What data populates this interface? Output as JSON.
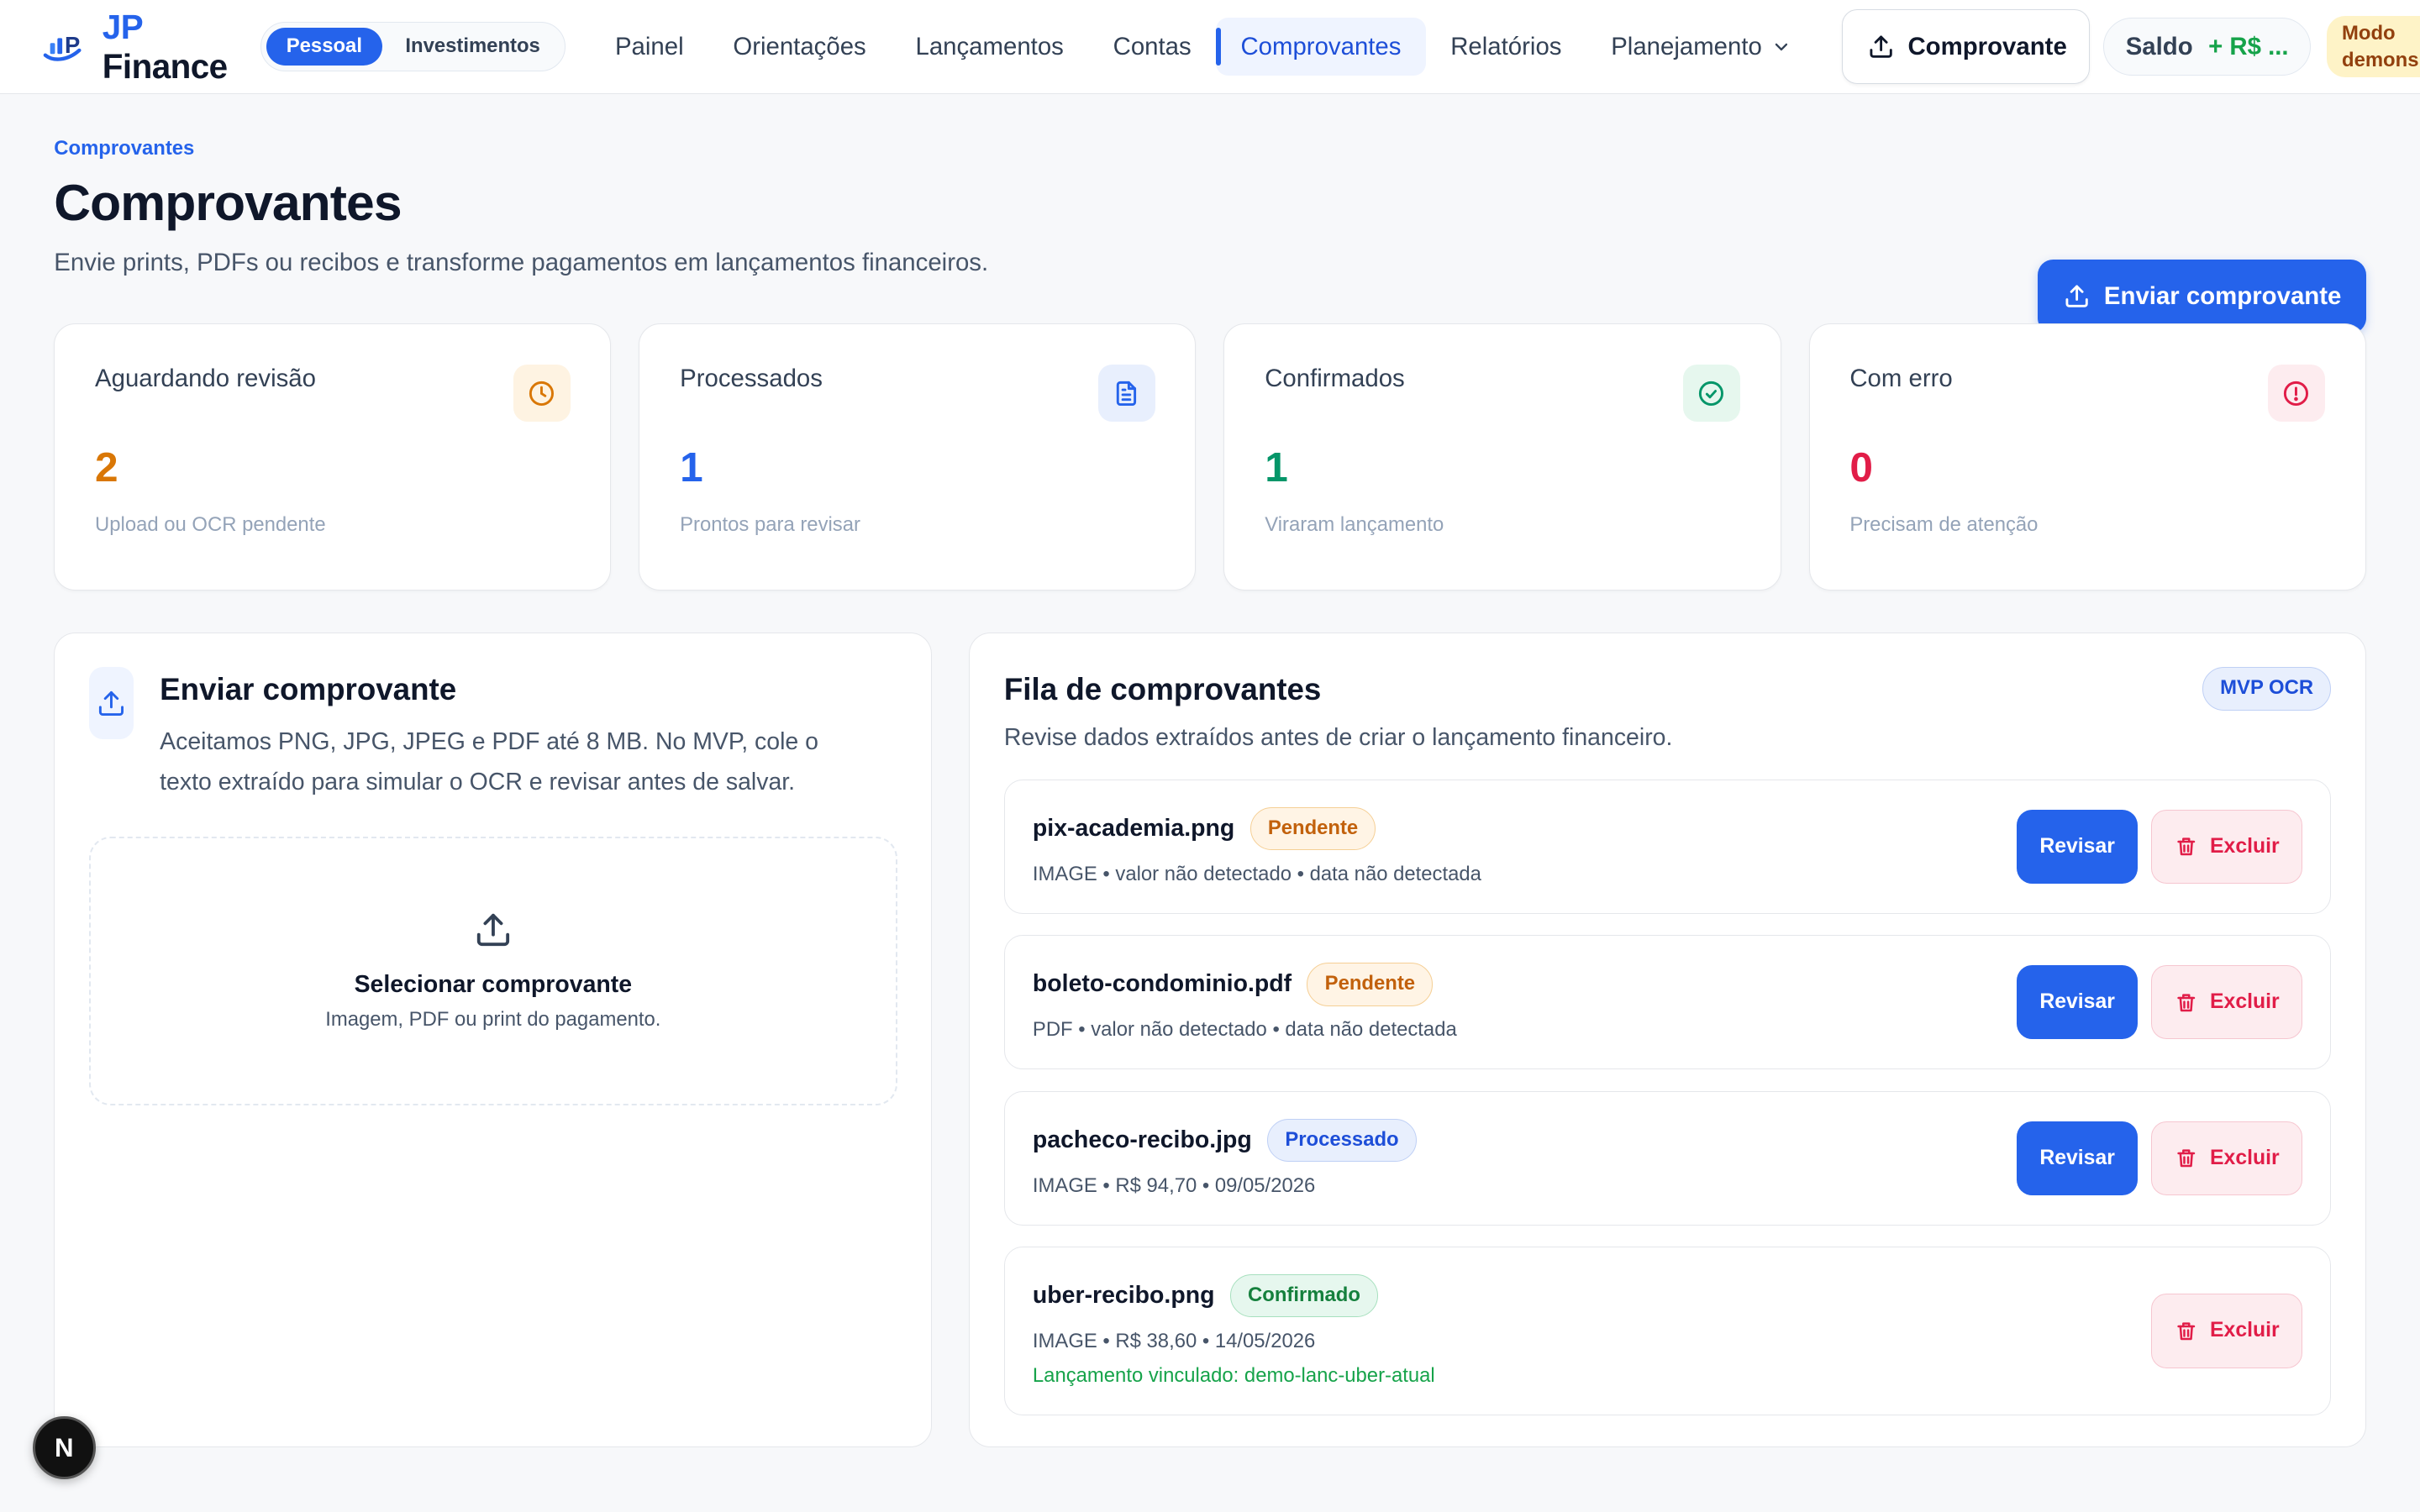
{
  "brand": {
    "prefix": "JP",
    "name": "Finance"
  },
  "mode_toggle": {
    "personal": "Pessoal",
    "investments": "Investimentos"
  },
  "nav": {
    "items": [
      {
        "label": "Painel"
      },
      {
        "label": "Orientações"
      },
      {
        "label": "Lançamentos"
      },
      {
        "label": "Contas"
      },
      {
        "label": "Comprovantes",
        "active": true
      },
      {
        "label": "Relatórios"
      },
      {
        "label": "Planejamento"
      }
    ],
    "upload_button": "Comprovante",
    "saldo_label": "Saldo",
    "saldo_value": "+ R$ ...",
    "demo_badge_line1": "Modo",
    "demo_badge_line2": "demons"
  },
  "header": {
    "breadcrumb": "Comprovantes",
    "title": "Comprovantes",
    "subtitle": "Envie prints, PDFs ou recibos e transforme pagamentos em lançamentos financeiros.",
    "primary_button": "Enviar comprovante"
  },
  "stats": [
    {
      "label": "Aguardando revisão",
      "value": "2",
      "desc": "Upload ou OCR pendente",
      "icon": "clock-icon",
      "color": "#d97706",
      "bg": "#fef3e2"
    },
    {
      "label": "Processados",
      "value": "1",
      "desc": "Prontos para revisar",
      "icon": "document-icon",
      "color": "#2563eb",
      "bg": "#e8effd"
    },
    {
      "label": "Confirmados",
      "value": "1",
      "desc": "Viraram lançamento",
      "icon": "check-circle-icon",
      "color": "#059669",
      "bg": "#e6f7ee"
    },
    {
      "label": "Com erro",
      "value": "0",
      "desc": "Precisam de atenção",
      "icon": "alert-circle-icon",
      "color": "#e11d48",
      "bg": "#fdecef"
    }
  ],
  "upload_panel": {
    "title": "Enviar comprovante",
    "description": "Aceitamos PNG, JPG, JPEG e PDF até 8 MB. No MVP, cole o texto extraído para simular o OCR e revisar antes de salvar.",
    "dropzone_title": "Selecionar comprovante",
    "dropzone_subtitle": "Imagem, PDF ou print do pagamento."
  },
  "queue_panel": {
    "title": "Fila de comprovantes",
    "subtitle": "Revise dados extraídos antes de criar o lançamento financeiro.",
    "badge": "MVP OCR",
    "review_label": "Revisar",
    "delete_label": "Excluir",
    "items": [
      {
        "name": "pix-academia.png",
        "status": "Pendente",
        "status_kind": "pend",
        "meta": "IMAGE • valor não detectado • data não detectada",
        "can_review": true
      },
      {
        "name": "boleto-condominio.pdf",
        "status": "Pendente",
        "status_kind": "pend",
        "meta": "PDF • valor não detectado • data não detectada",
        "can_review": true
      },
      {
        "name": "pacheco-recibo.jpg",
        "status": "Processado",
        "status_kind": "proc",
        "meta": "IMAGE • R$ 94,70 • 09/05/2026",
        "can_review": true
      },
      {
        "name": "uber-recibo.png",
        "status": "Confirmado",
        "status_kind": "conf",
        "meta": "IMAGE • R$ 38,60 • 14/05/2026",
        "link": "Lançamento vinculado: demo-lanc-uber-atual",
        "can_review": false
      }
    ]
  },
  "fab_label": "N"
}
